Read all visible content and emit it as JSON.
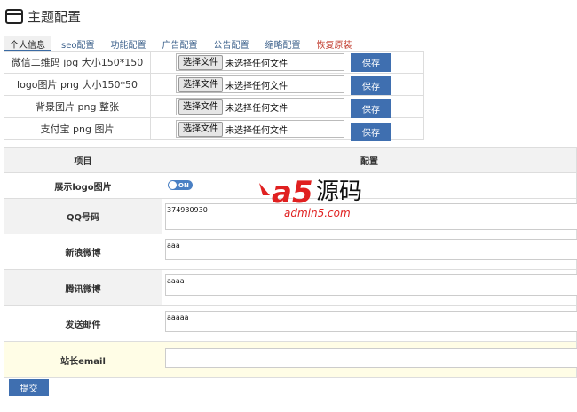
{
  "header": {
    "title": "主题配置"
  },
  "tabs": [
    {
      "label": "个人信息"
    },
    {
      "label": "seo配置"
    },
    {
      "label": "功能配置"
    },
    {
      "label": "广告配置"
    },
    {
      "label": "公告配置"
    },
    {
      "label": "缩略配置"
    },
    {
      "label": "恢复原装"
    }
  ],
  "uploads": [
    {
      "label": "微信二维码 jpg 大小150*150",
      "choose": "选择文件",
      "status": "未选择任何文件",
      "save": "保存"
    },
    {
      "label": "logo图片 png 大小150*50",
      "choose": "选择文件",
      "status": "未选择任何文件",
      "save": "保存"
    },
    {
      "label": "背景图片 png 整张",
      "choose": "选择文件",
      "status": "未选择任何文件",
      "save": "保存"
    },
    {
      "label": "支付宝 png 图片",
      "choose": "选择文件",
      "status": "未选择任何文件",
      "save": "保存"
    }
  ],
  "config": {
    "headers": {
      "item": "项目",
      "value": "配置"
    },
    "rows": [
      {
        "label": "展示logo图片",
        "toggle": "ON"
      },
      {
        "label": "QQ号码",
        "value": "374930930"
      },
      {
        "label": "新浪微博",
        "value": "aaa"
      },
      {
        "label": "腾讯微博",
        "value": "aaaa"
      },
      {
        "label": "发送邮件",
        "value": "aaaaa"
      },
      {
        "label": "站长email",
        "value": ""
      }
    ]
  },
  "submit_label": "提交",
  "watermark": {
    "logo": "a5",
    "text": "源码",
    "sub": "admin5.com"
  },
  "colors": {
    "accent": "#3f6fb0",
    "watermark_red": "#e02020",
    "restore_tab": "#c0392b"
  }
}
